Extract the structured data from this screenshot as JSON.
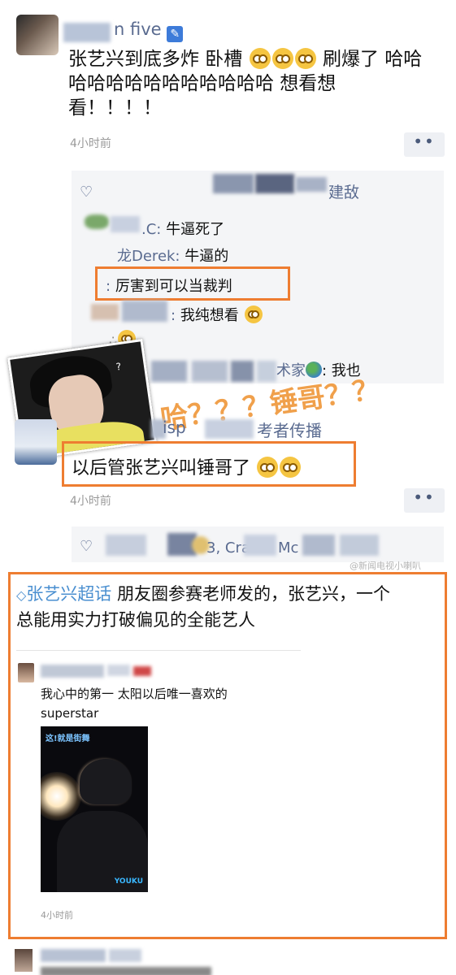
{
  "post1": {
    "username_suffix": "n five",
    "text_line1": "张艺兴到底多炸 卧槽",
    "text_line1b": "刷爆了 哈哈",
    "text_line2": "哈哈哈哈哈哈哈哈哈哈哈 想看想",
    "text_line3": "看！！！！",
    "time": "4小时前",
    "more": "••",
    "likes_suffix": "建敌",
    "comments": [
      {
        "nick": ".C:",
        "text": "牛逼死了"
      },
      {
        "nick": "龙Derek:",
        "text": "牛逼的"
      },
      {
        "nick": ":",
        "text": "厉害到可以当裁判"
      },
      {
        "nick": ":",
        "text": "我纯想看"
      },
      {
        "nick": "术家",
        "text": ": 我也"
      }
    ]
  },
  "sticker": {
    "text": "哈？？？锤哥？？",
    "q": "?"
  },
  "post2": {
    "username_partial": "isp",
    "username_partial2": "考者传播",
    "text": "以后管张艺兴叫锤哥了",
    "time": "4小时前",
    "more": "••",
    "likes_partial": "3, Cra",
    "likes_partial2": "Mc",
    "watermark": "@新闻电视小喇叭"
  },
  "post3": {
    "topic": "张艺兴超话",
    "text_line1": "朋友圈参赛老师发的，张艺兴，一个",
    "text_line2": "总能用实力打破偏见的全能艺人",
    "inner_text1": "我心中的第一 太阳以后唯一喜欢的",
    "inner_text2": "superstar",
    "inner_time": "4小时前",
    "logo": "YOUKU",
    "poster_title": "这!就是街舞"
  },
  "colors": {
    "highlight": "#ee7d31",
    "nick": "#5a6b90",
    "topic": "#4a8fd0"
  }
}
